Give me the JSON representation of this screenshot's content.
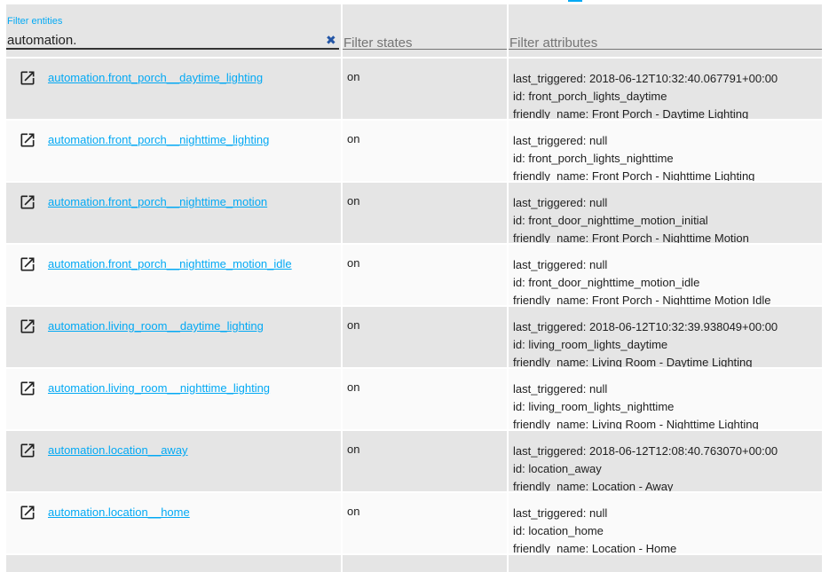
{
  "filters": {
    "entities_label": "Filter entities",
    "entities_value": "automation.",
    "states_placeholder": "Filter states",
    "attributes_placeholder": "Filter attributes",
    "clear_glyph": "✖"
  },
  "rows": [
    {
      "entity": "automation.front_porch__daytime_lighting",
      "state": "on",
      "attrs": [
        "last_triggered: 2018-06-12T10:32:40.067791+00:00",
        "id: front_porch_lights_daytime",
        "friendly_name: Front Porch - Daytime Lighting"
      ]
    },
    {
      "entity": "automation.front_porch__nighttime_lighting",
      "state": "on",
      "attrs": [
        "last_triggered: null",
        "id: front_porch_lights_nighttime",
        "friendly_name: Front Porch - Nighttime Lighting"
      ]
    },
    {
      "entity": "automation.front_porch__nighttime_motion",
      "state": "on",
      "attrs": [
        "last_triggered: null",
        "id: front_door_nighttime_motion_initial",
        "friendly_name: Front Porch - Nighttime Motion"
      ]
    },
    {
      "entity": "automation.front_porch__nighttime_motion_idle",
      "state": "on",
      "attrs": [
        "last_triggered: null",
        "id: front_door_nighttime_motion_idle",
        "friendly_name: Front Porch - Nighttime Motion Idle"
      ]
    },
    {
      "entity": "automation.living_room__daytime_lighting",
      "state": "on",
      "attrs": [
        "last_triggered: 2018-06-12T10:32:39.938049+00:00",
        "id: living_room_lights_daytime",
        "friendly_name: Living Room - Daytime Lighting"
      ]
    },
    {
      "entity": "automation.living_room__nighttime_lighting",
      "state": "on",
      "attrs": [
        "last_triggered: null",
        "id: living_room_lights_nighttime",
        "friendly_name: Living Room - Nighttime Lighting"
      ]
    },
    {
      "entity": "automation.location__away",
      "state": "on",
      "attrs": [
        "last_triggered: 2018-06-12T12:08:40.763070+00:00",
        "id: location_away",
        "friendly_name: Location - Away"
      ]
    },
    {
      "entity": "automation.location__home",
      "state": "on",
      "attrs": [
        "last_triggered: null",
        "id: location_home",
        "friendly_name: Location - Home"
      ]
    }
  ],
  "icons": {
    "row_icon": "open-in-new-icon",
    "clear_icon": "close-icon"
  }
}
